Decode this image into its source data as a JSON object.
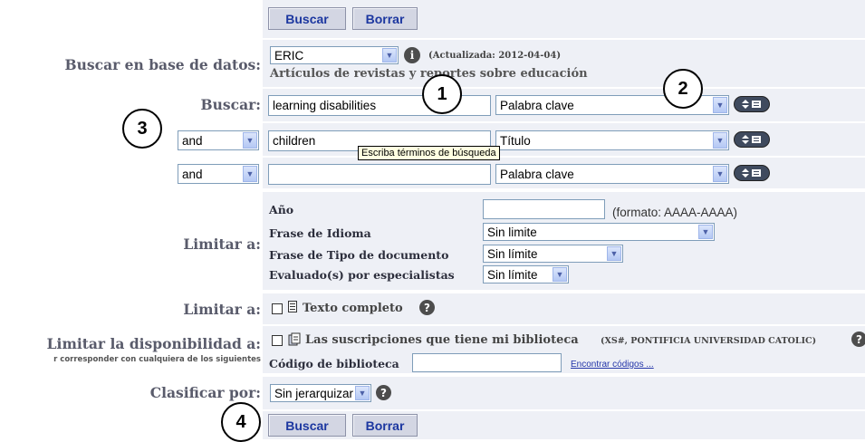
{
  "buttons": {
    "search": "Buscar",
    "clear": "Borrar"
  },
  "database": {
    "label": "Buscar en base de datos:",
    "selected": "ERIC",
    "updated": "(Actualizada: 2012-04-04)",
    "description": "Artículos de revistas y reportes sobre educación"
  },
  "search": {
    "label": "Buscar:",
    "rows": [
      {
        "term": "learning disabilities",
        "field": "Palabra clave"
      },
      {
        "operator": "and",
        "term": "children",
        "field": "Título"
      },
      {
        "operator": "and",
        "term": "",
        "field": "Palabra clave"
      }
    ],
    "tooltip": "Escriba términos de búsqueda"
  },
  "limits": {
    "label": "Limitar a:",
    "year_label": "Año",
    "year_value": "",
    "year_hint": "(formato: AAAA-AAAA)",
    "language_label": "Frase de Idioma",
    "language_value": "Sin limite",
    "doctype_label": "Frase de Tipo de documento",
    "doctype_value": "Sin límite",
    "peer_label": "Evaluado(s) por especialistas",
    "peer_value": "Sin límite"
  },
  "fulltext": {
    "label": "Limitar a:",
    "text": "Texto completo"
  },
  "availability": {
    "label": "Limitar la disponibilidad a:",
    "sublabel": "r corresponder con cualquiera de los siguientes",
    "subscriptions": "Las suscripciones que tiene mi biblioteca",
    "subscriptions_note": "(XS#, PONTIFICIA UNIVERSIDAD CATOLIC)",
    "code_label": "Código de biblioteca",
    "code_value": "",
    "find_codes": "Encontrar códigos ..."
  },
  "sort": {
    "label": "Clasificar por:",
    "selected": "Sin jerarquizar"
  },
  "callouts": [
    "1",
    "2",
    "3",
    "4"
  ],
  "icons": {
    "info": "info-icon",
    "help": "help-icon",
    "expand": "expand-icon",
    "dropdown": "chevron-down-icon",
    "document": "document-icon",
    "subscription": "subscription-icon"
  },
  "colors": {
    "band": "#eef0f6",
    "button_text": "#1c37a0",
    "label": "#595b6b",
    "link": "#2335a8"
  }
}
